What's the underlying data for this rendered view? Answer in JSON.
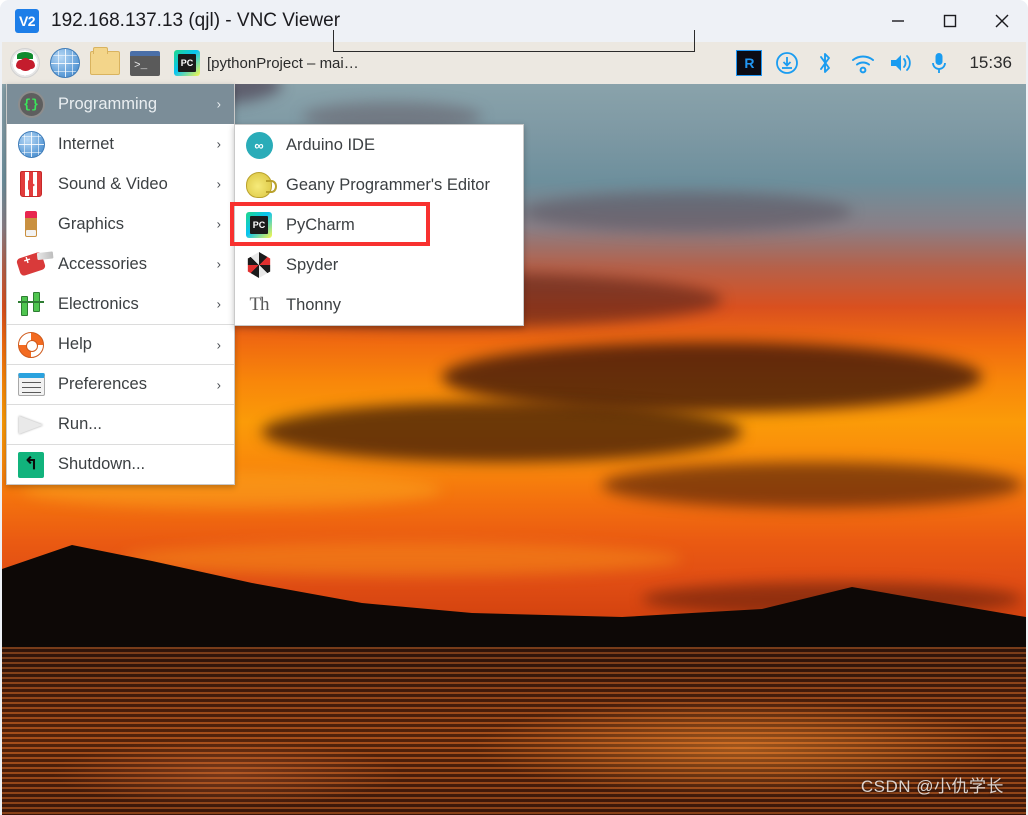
{
  "window": {
    "title": "192.168.137.13 (qjl) - VNC Viewer",
    "logo_text": "V2",
    "logo_icon": "vnc-logo-icon",
    "controls": {
      "minimize": "minimize-icon",
      "maximize": "maximize-icon",
      "close": "close-icon"
    }
  },
  "remote_taskbar": {
    "launchers": [
      {
        "name": "raspberry-menu-icon",
        "label": "Raspberry Pi Menu"
      },
      {
        "name": "web-browser-icon",
        "label": "Web Browser"
      },
      {
        "name": "file-manager-icon",
        "label": "File Manager"
      },
      {
        "name": "terminal-icon",
        "label": "Terminal"
      }
    ],
    "window_button": {
      "icon": "pycharm-icon",
      "label": "[pythonProject – mai…"
    },
    "tray": [
      {
        "name": "realvnc-server-icon",
        "label": "RVNC"
      },
      {
        "name": "updates-icon",
        "label": "Updates"
      },
      {
        "name": "bluetooth-icon",
        "label": "Bluetooth"
      },
      {
        "name": "wifi-icon",
        "label": "Wi-Fi"
      },
      {
        "name": "volume-icon",
        "label": "Volume"
      },
      {
        "name": "microphone-icon",
        "label": "Microphone"
      }
    ],
    "clock": "15:36"
  },
  "main_menu": {
    "items": [
      {
        "label": "Programming",
        "icon": "programming-icon",
        "has_submenu": true,
        "selected": true,
        "separator_above": false
      },
      {
        "label": "Internet",
        "icon": "internet-icon",
        "has_submenu": true,
        "selected": false,
        "separator_above": false
      },
      {
        "label": "Sound & Video",
        "icon": "sound-video-icon",
        "has_submenu": true,
        "selected": false,
        "separator_above": false
      },
      {
        "label": "Graphics",
        "icon": "graphics-icon",
        "has_submenu": true,
        "selected": false,
        "separator_above": false
      },
      {
        "label": "Accessories",
        "icon": "accessories-icon",
        "has_submenu": true,
        "selected": false,
        "separator_above": false
      },
      {
        "label": "Electronics",
        "icon": "electronics-icon",
        "has_submenu": true,
        "selected": false,
        "separator_above": false
      },
      {
        "label": "Help",
        "icon": "help-icon",
        "has_submenu": true,
        "selected": false,
        "separator_above": true
      },
      {
        "label": "Preferences",
        "icon": "preferences-icon",
        "has_submenu": true,
        "selected": false,
        "separator_above": true
      },
      {
        "label": "Run...",
        "icon": "run-icon",
        "has_submenu": false,
        "selected": false,
        "separator_above": true
      },
      {
        "label": "Shutdown...",
        "icon": "shutdown-icon",
        "has_submenu": false,
        "selected": false,
        "separator_above": true
      }
    ],
    "submenu_arrow": "›"
  },
  "submenu": {
    "parent": "Programming",
    "items": [
      {
        "label": "Arduino IDE",
        "icon": "arduino-icon",
        "highlighted": false
      },
      {
        "label": "Geany Programmer's Editor",
        "icon": "geany-icon",
        "highlighted": false
      },
      {
        "label": "PyCharm",
        "icon": "pycharm-icon",
        "highlighted": true
      },
      {
        "label": "Spyder",
        "icon": "spyder-icon",
        "highlighted": false
      },
      {
        "label": "Thonny",
        "icon": "thonny-icon",
        "highlighted": false
      }
    ]
  },
  "annotation": {
    "target": "PyCharm",
    "color": "#f8312f"
  },
  "watermark": "CSDN @小仇学长",
  "colors": {
    "titlebar_bg": "#eef1f6",
    "taskbar_bg": "#ece8e1",
    "menu_bg": "#ffffff",
    "menu_selected_bg": "#7b8d98",
    "menu_text": "#3c4043",
    "accent_red": "#f8312f",
    "tray_blue": "#1a9cf0"
  }
}
